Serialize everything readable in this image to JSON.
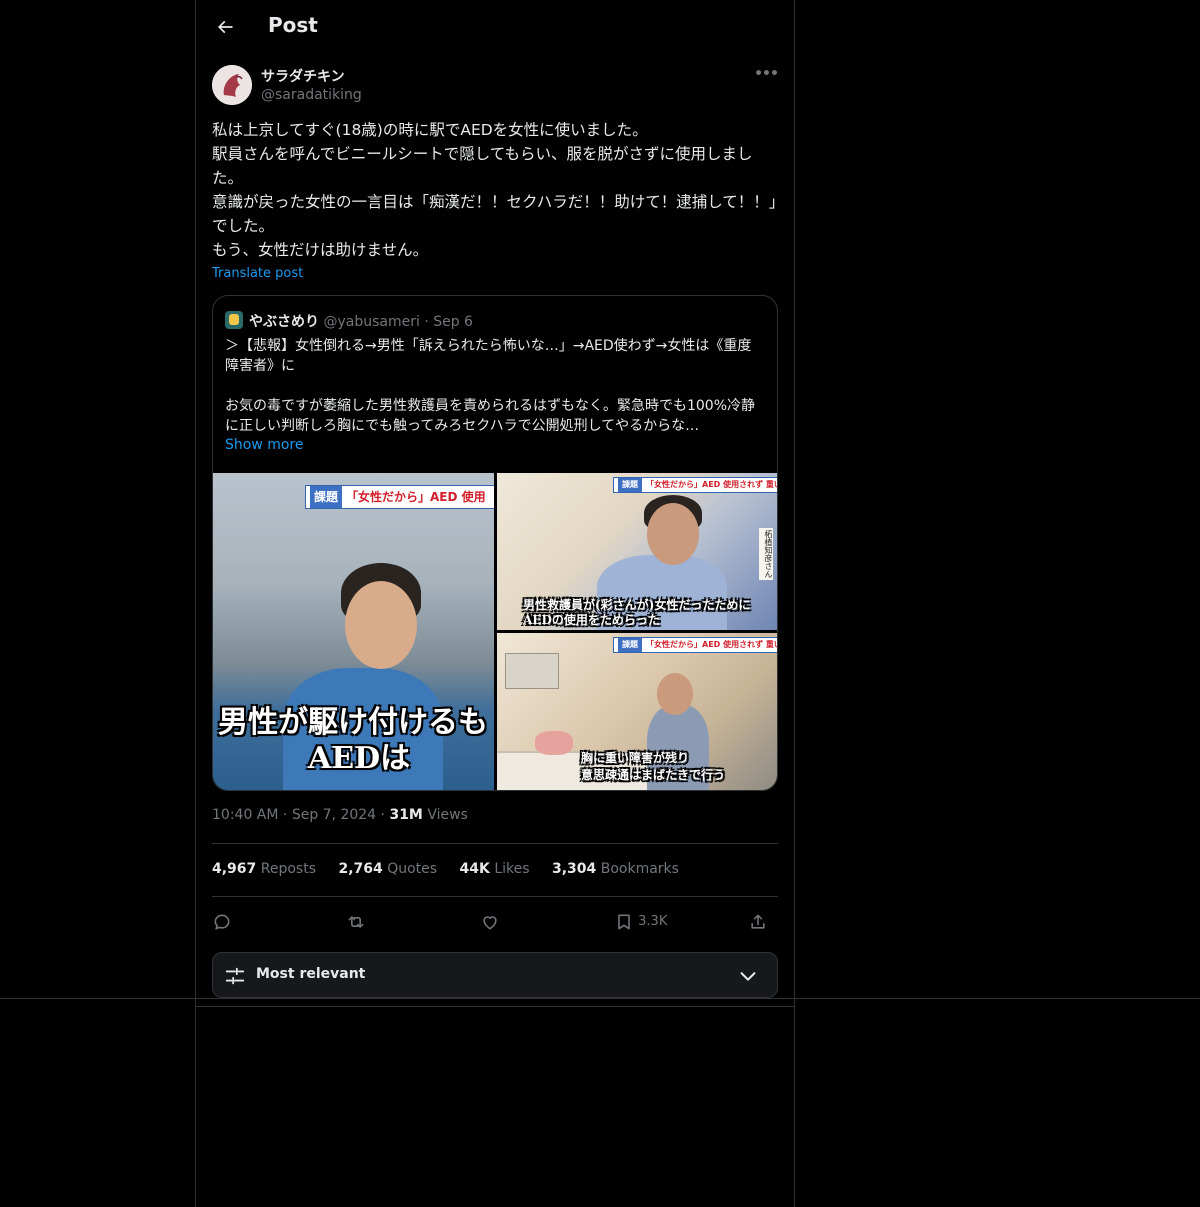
{
  "header": {
    "title": "Post"
  },
  "author": {
    "display_name": "サラダチキン",
    "handle": "@saradatiking"
  },
  "post": {
    "text": "私は上京してすぐ(18歳)の時に駅でAEDを女性に使いました。\n駅員さんを呼んでビニールシートで隠してもらい、服を脱がさずに使用しました。\n意識が戻った女性の一言目は「痴漢だ！！セクハラだ！！助けて！逮捕して！！」でした。\nもう、女性だけは助けません。",
    "translate_label": "Translate post"
  },
  "quote": {
    "display_name": "やぶさめり",
    "handle": "@yabusameri",
    "separator": "·",
    "date": "Sep 6",
    "text": "＞【悲報】女性倒れる→男性「訴えられたら怖いな…」→AED使わず→女性は《重度障害者》に\n\nお気の毒ですが萎縮した男性救護員を責められるはずもなく。緊急時でも100%冷静に正しい判断しろ胸にでも触ってみろセクハラで公開処刑してやるからな…",
    "show_more": "Show more",
    "media": {
      "main": {
        "banner_tag": "課題",
        "banner_text": "「女性だから」AED 使用",
        "caption": "男性が駆け付けるも\n　　　AEDは"
      },
      "top_right": {
        "banner_tag": "課題",
        "banner_text": "「女性だから」AED 使用されず 重い後遺症",
        "name_tag": "柘植知彦さん",
        "caption": "男性救護員が(彩さんが)女性だったために\nAEDの使用をためらった"
      },
      "bottom_right": {
        "banner_tag": "課題",
        "banner_text": "「女性だから」AED 使用されず 重い後遺症",
        "caption": "胸に重い障害が残り\n意思疎通はまばたきで行う"
      }
    }
  },
  "meta": {
    "time": "10:40 AM",
    "dot": "·",
    "date": "Sep 7, 2024",
    "views_count": "31M",
    "views_label": "Views"
  },
  "stats": {
    "reposts_count": "4,967",
    "reposts_label": "Reposts",
    "quotes_count": "2,764",
    "quotes_label": "Quotes",
    "likes_count": "44K",
    "likes_label": "Likes",
    "bookmarks_count": "3,304",
    "bookmarks_label": "Bookmarks"
  },
  "actions": {
    "bookmark_count": "3.3K"
  },
  "sort": {
    "label": "Most relevant"
  },
  "icons": [
    "back-arrow-icon",
    "more-icon",
    "reply-icon",
    "repost-icon",
    "like-icon",
    "bookmark-icon",
    "share-icon",
    "sliders-icon",
    "chevron-down-icon"
  ]
}
